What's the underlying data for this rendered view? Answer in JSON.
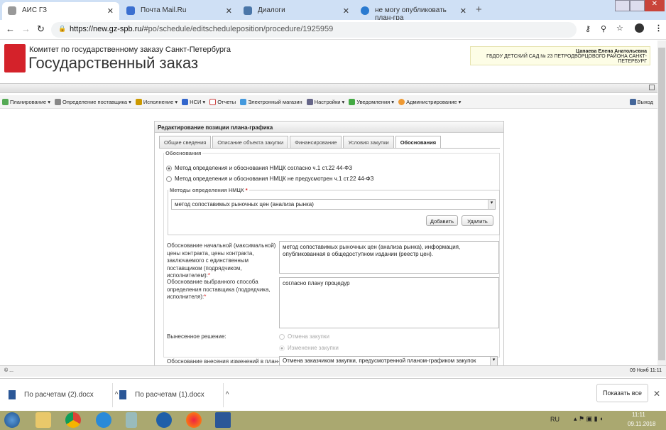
{
  "browser": {
    "tabs": [
      {
        "title": "АИС ГЗ",
        "active": true
      },
      {
        "title": "Почта Mail.Ru"
      },
      {
        "title": "Диалоги"
      },
      {
        "title": "не могу опубликовать план-гра"
      }
    ],
    "url_host": "https://new.gz-spb.ru/",
    "url_path": "#po/schedule/editscheduleposition/procedure/1925959"
  },
  "site": {
    "subtitle": "Комитет по государственному заказу Санкт-Петербурга",
    "title": "Государственный заказ",
    "user_name": "Цапаева Елена Анатольевна",
    "org": "ГБДОУ ДЕТСКИЙ САД № 23 ПЕТРОДВОРЦОВОГО РАЙОНА САНКТ-ПЕТЕРБУРГ"
  },
  "menu": {
    "items": [
      "Планирование ▾",
      "Определение поставщика ▾",
      "Исполнение ▾",
      "НСИ ▾",
      "Отчеты",
      "Электронный магазин",
      "Настройки ▾",
      "Уведомления ▾",
      "Администрирование ▾"
    ],
    "exit": "Выход"
  },
  "dialog": {
    "title": "Редактирование позиции плана-графика",
    "tabs": [
      "Общие сведения",
      "Описание объекта закупки",
      "Финансирование",
      "Условия закупки",
      "Обоснования"
    ],
    "group": "Обоснования",
    "radio1": "Метод определения и обоснования НМЦК согласно ч.1 ст.22 44-ФЗ",
    "radio2": "Метод определения и обоснования НМЦК не предусмотрен ч.1 ст.22 44-ФЗ",
    "methods_legend": "Методы определения НМЦК",
    "method_value": "метод сопоставимых рыночных цен (анализа рынка)",
    "add": "Добавить",
    "delete": "Удалить",
    "nmck_label": "Обоснование начальной (максимальной) цены контракта, цены контракта, заключаемого с единственным поставщиком (подрядчиком, исполнителем):",
    "nmck_value": "метод сопоставимых рыночных цен (анализа рынка), информация, опубликованная в общедоступном издании (реестр цен).",
    "method_choice_label": "Обоснование выбранного способа определения поставщика (подрядчика, исполнителя):",
    "method_choice_value": "согласно плану процедур",
    "decision_label": "Вынесенное решение:",
    "decision_opt1": "Отмена закупки",
    "decision_opt2": "Изменение закупки",
    "change_label": "Обоснование внесения изменений в план-",
    "change_value": "Отмена заказчиком закупки, предусмотренной планом-графиком закупок",
    "required": "*"
  },
  "status": {
    "left": "© ...",
    "right": "09 Нояб 11:11"
  },
  "downloads": {
    "items": [
      "По расчетам (2).docx",
      "По расчетам (1).docx"
    ],
    "show_all": "Показать все"
  },
  "taskbar": {
    "lang": "RU",
    "time": "11:11",
    "date": "09.11.2018"
  }
}
